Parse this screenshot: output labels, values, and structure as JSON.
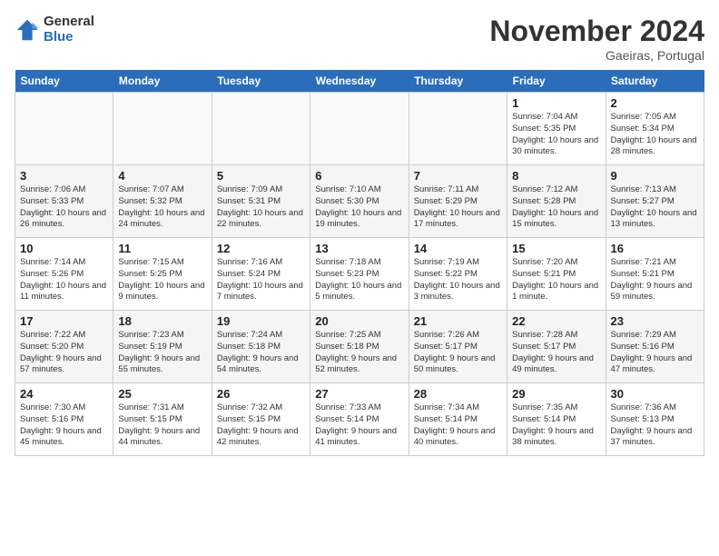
{
  "logo": {
    "general": "General",
    "blue": "Blue"
  },
  "header": {
    "month": "November 2024",
    "location": "Gaeiras, Portugal"
  },
  "weekdays": [
    "Sunday",
    "Monday",
    "Tuesday",
    "Wednesday",
    "Thursday",
    "Friday",
    "Saturday"
  ],
  "weeks": [
    [
      {
        "day": "",
        "info": ""
      },
      {
        "day": "",
        "info": ""
      },
      {
        "day": "",
        "info": ""
      },
      {
        "day": "",
        "info": ""
      },
      {
        "day": "",
        "info": ""
      },
      {
        "day": "1",
        "info": "Sunrise: 7:04 AM\nSunset: 5:35 PM\nDaylight: 10 hours and 30 minutes."
      },
      {
        "day": "2",
        "info": "Sunrise: 7:05 AM\nSunset: 5:34 PM\nDaylight: 10 hours and 28 minutes."
      }
    ],
    [
      {
        "day": "3",
        "info": "Sunrise: 7:06 AM\nSunset: 5:33 PM\nDaylight: 10 hours and 26 minutes."
      },
      {
        "day": "4",
        "info": "Sunrise: 7:07 AM\nSunset: 5:32 PM\nDaylight: 10 hours and 24 minutes."
      },
      {
        "day": "5",
        "info": "Sunrise: 7:09 AM\nSunset: 5:31 PM\nDaylight: 10 hours and 22 minutes."
      },
      {
        "day": "6",
        "info": "Sunrise: 7:10 AM\nSunset: 5:30 PM\nDaylight: 10 hours and 19 minutes."
      },
      {
        "day": "7",
        "info": "Sunrise: 7:11 AM\nSunset: 5:29 PM\nDaylight: 10 hours and 17 minutes."
      },
      {
        "day": "8",
        "info": "Sunrise: 7:12 AM\nSunset: 5:28 PM\nDaylight: 10 hours and 15 minutes."
      },
      {
        "day": "9",
        "info": "Sunrise: 7:13 AM\nSunset: 5:27 PM\nDaylight: 10 hours and 13 minutes."
      }
    ],
    [
      {
        "day": "10",
        "info": "Sunrise: 7:14 AM\nSunset: 5:26 PM\nDaylight: 10 hours and 11 minutes."
      },
      {
        "day": "11",
        "info": "Sunrise: 7:15 AM\nSunset: 5:25 PM\nDaylight: 10 hours and 9 minutes."
      },
      {
        "day": "12",
        "info": "Sunrise: 7:16 AM\nSunset: 5:24 PM\nDaylight: 10 hours and 7 minutes."
      },
      {
        "day": "13",
        "info": "Sunrise: 7:18 AM\nSunset: 5:23 PM\nDaylight: 10 hours and 5 minutes."
      },
      {
        "day": "14",
        "info": "Sunrise: 7:19 AM\nSunset: 5:22 PM\nDaylight: 10 hours and 3 minutes."
      },
      {
        "day": "15",
        "info": "Sunrise: 7:20 AM\nSunset: 5:21 PM\nDaylight: 10 hours and 1 minute."
      },
      {
        "day": "16",
        "info": "Sunrise: 7:21 AM\nSunset: 5:21 PM\nDaylight: 9 hours and 59 minutes."
      }
    ],
    [
      {
        "day": "17",
        "info": "Sunrise: 7:22 AM\nSunset: 5:20 PM\nDaylight: 9 hours and 57 minutes."
      },
      {
        "day": "18",
        "info": "Sunrise: 7:23 AM\nSunset: 5:19 PM\nDaylight: 9 hours and 55 minutes."
      },
      {
        "day": "19",
        "info": "Sunrise: 7:24 AM\nSunset: 5:18 PM\nDaylight: 9 hours and 54 minutes."
      },
      {
        "day": "20",
        "info": "Sunrise: 7:25 AM\nSunset: 5:18 PM\nDaylight: 9 hours and 52 minutes."
      },
      {
        "day": "21",
        "info": "Sunrise: 7:26 AM\nSunset: 5:17 PM\nDaylight: 9 hours and 50 minutes."
      },
      {
        "day": "22",
        "info": "Sunrise: 7:28 AM\nSunset: 5:17 PM\nDaylight: 9 hours and 49 minutes."
      },
      {
        "day": "23",
        "info": "Sunrise: 7:29 AM\nSunset: 5:16 PM\nDaylight: 9 hours and 47 minutes."
      }
    ],
    [
      {
        "day": "24",
        "info": "Sunrise: 7:30 AM\nSunset: 5:16 PM\nDaylight: 9 hours and 45 minutes."
      },
      {
        "day": "25",
        "info": "Sunrise: 7:31 AM\nSunset: 5:15 PM\nDaylight: 9 hours and 44 minutes."
      },
      {
        "day": "26",
        "info": "Sunrise: 7:32 AM\nSunset: 5:15 PM\nDaylight: 9 hours and 42 minutes."
      },
      {
        "day": "27",
        "info": "Sunrise: 7:33 AM\nSunset: 5:14 PM\nDaylight: 9 hours and 41 minutes."
      },
      {
        "day": "28",
        "info": "Sunrise: 7:34 AM\nSunset: 5:14 PM\nDaylight: 9 hours and 40 minutes."
      },
      {
        "day": "29",
        "info": "Sunrise: 7:35 AM\nSunset: 5:14 PM\nDaylight: 9 hours and 38 minutes."
      },
      {
        "day": "30",
        "info": "Sunrise: 7:36 AM\nSunset: 5:13 PM\nDaylight: 9 hours and 37 minutes."
      }
    ]
  ]
}
